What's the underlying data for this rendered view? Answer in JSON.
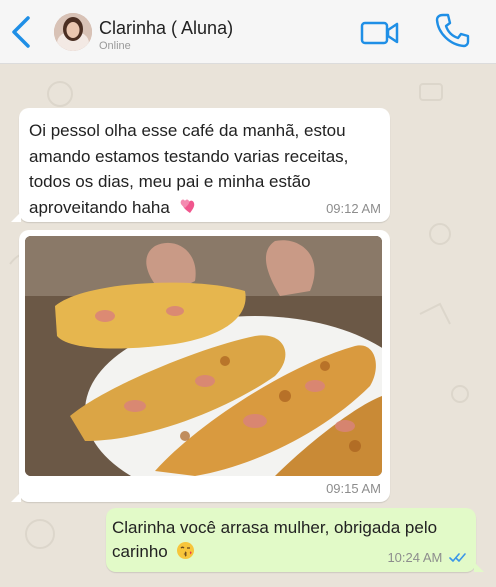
{
  "header": {
    "contact_name": "Clarinha ( Aluna)",
    "status": "Online",
    "icons": {
      "back": "chevron-left-icon",
      "video": "video-call-icon",
      "call": "phone-icon"
    },
    "accent_color": "#1f8fe6"
  },
  "messages": [
    {
      "direction": "incoming",
      "text": "Oi pessol olha esse café da manhã, estou amando estamos testando varias receitas, todos os dias, meu pai e minha estão aproveitando haha",
      "emoji": "two-hearts",
      "time": "09:12 AM"
    },
    {
      "direction": "incoming",
      "type": "image",
      "image_subject": "food-photo",
      "time": "09:15 AM"
    },
    {
      "direction": "outgoing",
      "text": "Clarinha você arrasa mulher, obrigada pelo carinho",
      "emoji": "kissing-face",
      "time": "10:24 AM",
      "read_receipt": "double-check-blue"
    }
  ],
  "colors": {
    "chat_background": "#e9e3d9",
    "incoming_bubble": "#ffffff",
    "outgoing_bubble": "#e2fac8",
    "read_tick": "#3b96e8"
  }
}
